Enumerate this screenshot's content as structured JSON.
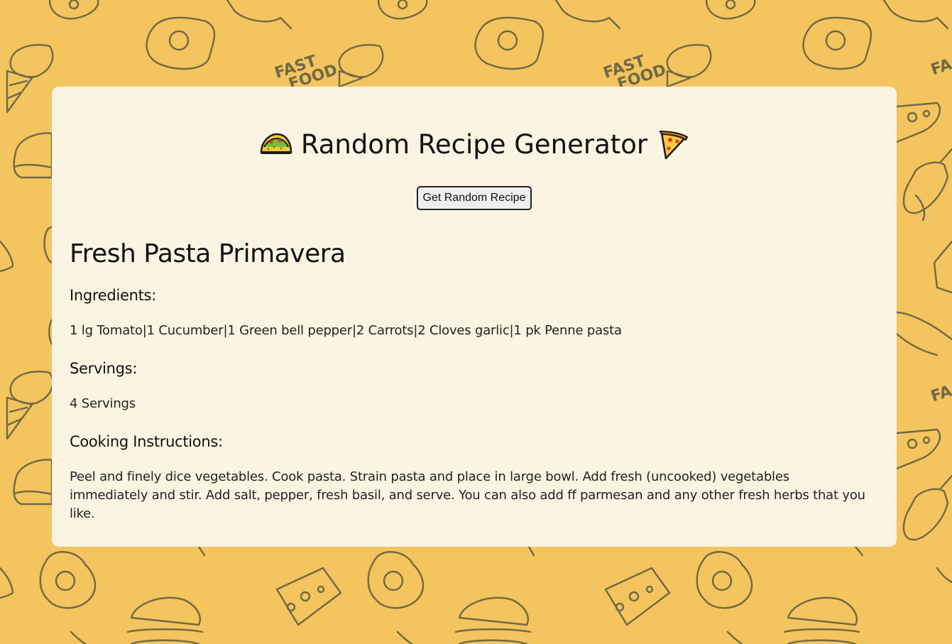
{
  "header": {
    "title": "Random Recipe Generator",
    "left_emoji": "taco-icon",
    "right_emoji": "pizza-icon"
  },
  "controls": {
    "get_button_label": "Get Random Recipe"
  },
  "recipe": {
    "name": "Fresh Pasta Primavera",
    "ingredients_heading": "Ingredients:",
    "ingredients": "1 lg Tomato|1 Cucumber|1 Green bell pepper|2 Carrots|2 Cloves garlic|1 pk Penne pasta",
    "servings_heading": "Servings:",
    "servings": "4 Servings",
    "instructions_heading": "Cooking Instructions:",
    "instructions": "Peel and finely dice vegetables. Cook pasta. Strain pasta and place in large bowl. Add fresh (uncooked) vegetables immediately and stir. Add salt, pepper, fresh basil, and serve. You can also add ff parmesan and any other fresh herbs that you like."
  },
  "theme": {
    "background": "#f4c45e",
    "card": "#fcf4e2",
    "doodle": "#6f6a45"
  },
  "background_pattern": {
    "doodle_text": "FAST FOOD",
    "icons": [
      "fried-egg-icon",
      "ice-cream-cone-icon",
      "burger-icon",
      "cheese-icon",
      "donut-icon",
      "pizza-slice-icon",
      "chicken-leg-icon",
      "popsicle-icon"
    ]
  }
}
